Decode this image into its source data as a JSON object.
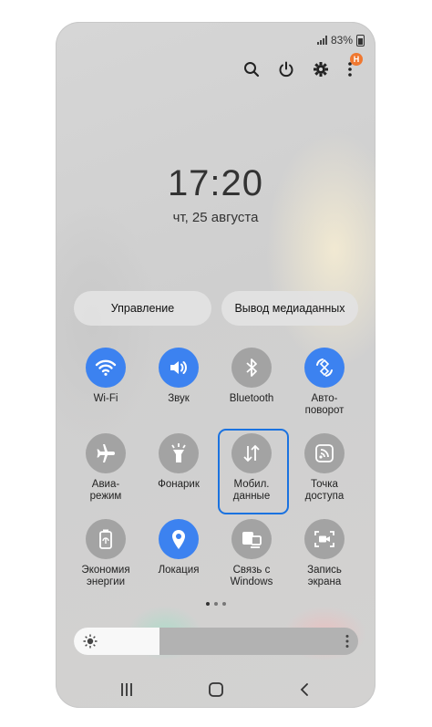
{
  "status_bar": {
    "battery_text": "83%"
  },
  "top_actions": {
    "search": "search-icon",
    "power": "power-icon",
    "settings": "gear-icon",
    "more": "more-vertical-icon",
    "badge_text": "H"
  },
  "lock": {
    "time": "17:20",
    "date": "чт, 25 августа"
  },
  "pills": {
    "left_label": "Управление",
    "right_label": "Вывод медиаданных"
  },
  "tiles": [
    {
      "label": "Wi-Fi",
      "icon": "wifi-icon",
      "active": true
    },
    {
      "label": "Звук",
      "icon": "speaker-icon",
      "active": true
    },
    {
      "label": "Bluetooth",
      "icon": "bluetooth-icon",
      "active": false
    },
    {
      "label": "Авто-\nповорот",
      "icon": "auto-rotate-icon",
      "active": true
    },
    {
      "label": "Авиа-\nрежим",
      "icon": "airplane-icon",
      "active": false
    },
    {
      "label": "Фонарик",
      "icon": "flashlight-icon",
      "active": false
    },
    {
      "label": "Мобил.\nданные",
      "icon": "mobile-data-icon",
      "active": false,
      "highlighted": true
    },
    {
      "label": "Точка\nдоступа",
      "icon": "hotspot-icon",
      "active": false
    },
    {
      "label": "Экономия\nэнергии",
      "icon": "battery-saver-icon",
      "active": false
    },
    {
      "label": "Локация",
      "icon": "location-icon",
      "active": true
    },
    {
      "label": "Связь с\nWindows",
      "icon": "link-to-windows-icon",
      "active": false
    },
    {
      "label": "Запись\nэкрана",
      "icon": "screen-record-icon",
      "active": false
    }
  ],
  "page_indicator": {
    "count": 3,
    "active": 0
  },
  "brightness": {
    "level_percent": 30
  },
  "colors": {
    "accent": "#3c82f0",
    "inactive": "#a3a3a3",
    "highlight_border": "#1a72e0",
    "badge": "#f07830"
  }
}
